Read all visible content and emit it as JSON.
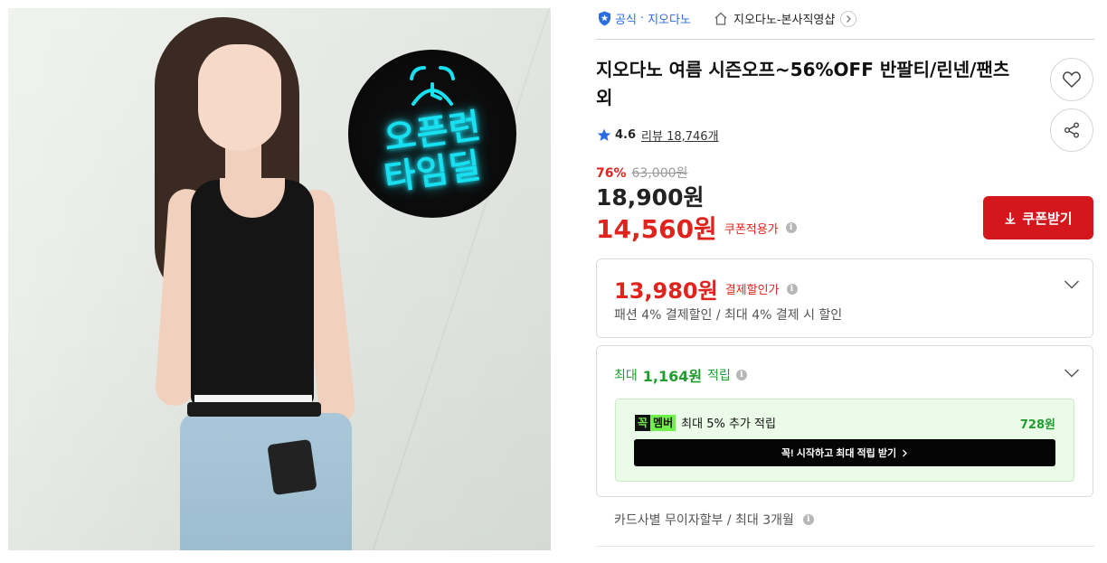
{
  "product_image": {
    "badge_line1": "오픈런",
    "badge_line2": "타임딜",
    "badge_color": "#18e0f0"
  },
  "brand": {
    "official_label": "공식",
    "official_separator": "·",
    "brand_name": "지오다노",
    "store_name": "지오다노-본사직영샵"
  },
  "product": {
    "title": "지오다노 여름 시즌오프~56%OFF 반팔티/린넨/팬츠 외",
    "rating": "4.6",
    "review_label": "리뷰",
    "review_count": "18,746개"
  },
  "price": {
    "discount_rate": "76%",
    "original_price": "63,000원",
    "sale_price": "18,900원",
    "coupon_price": "14,560원",
    "coupon_label": "쿠폰적용가",
    "coupon_button": "쿠폰받기"
  },
  "payment": {
    "price": "13,980원",
    "label": "결제할인가",
    "description": "패션 4% 결제할인 / 최대 4% 결제 시 할인"
  },
  "points": {
    "prefix": "최대",
    "amount": "1,164원",
    "suffix": "적립",
    "member_tag_k": "꼭",
    "member_tag_m": "멤버",
    "member_text": "최대 5% 추가 적립",
    "member_amount": "728원",
    "member_cta": "꼭! 시작하고 최대 적립 받기"
  },
  "installment": {
    "text": "카드사별 무이자할부 / 최대 3개월"
  },
  "colors": {
    "accent_red": "#e0241d",
    "button_red": "#d5161c",
    "official_blue": "#2b6de0",
    "point_green": "#1f9e2e",
    "member_green": "#6ff04a"
  }
}
